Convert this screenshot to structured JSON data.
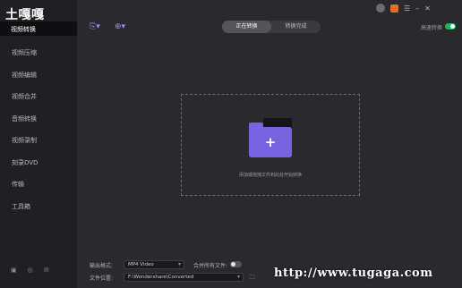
{
  "logo": "土嘎嘎",
  "watermark": "http://www.tugaga.com",
  "sidebar": {
    "selected": "视频转换",
    "items": [
      {
        "label": "视频压缩"
      },
      {
        "label": "视频编辑"
      },
      {
        "label": "视频合并"
      },
      {
        "label": "音频转换"
      },
      {
        "label": "视频录制"
      },
      {
        "label": "刻录DVD"
      },
      {
        "label": "传输"
      },
      {
        "label": "工具箱"
      }
    ]
  },
  "topbar": {
    "tabs": [
      {
        "label": "正在转换",
        "active": true
      },
      {
        "label": "转换完成",
        "active": false
      }
    ],
    "hw_accel_label": "高速转换",
    "window_controls": [
      "avatar",
      "gift-icon",
      "menu-icon",
      "minimize-icon",
      "close-icon"
    ]
  },
  "dropzone": {
    "hint": "添加或拖拽文件到此处开始转换"
  },
  "bottom": {
    "output_format_label": "输出格式:",
    "output_format_value": "MP4 Video",
    "merge_label": "合并所有文件:",
    "merge_on": false,
    "file_location_label": "文件位置:",
    "file_location_value": "F:\\Wondershare\\Converted"
  },
  "colors": {
    "accent": "#7864e0",
    "toggle_on": "#1fb65a",
    "sidebar_bg": "#202024",
    "main_bg": "#2a2a2e"
  }
}
